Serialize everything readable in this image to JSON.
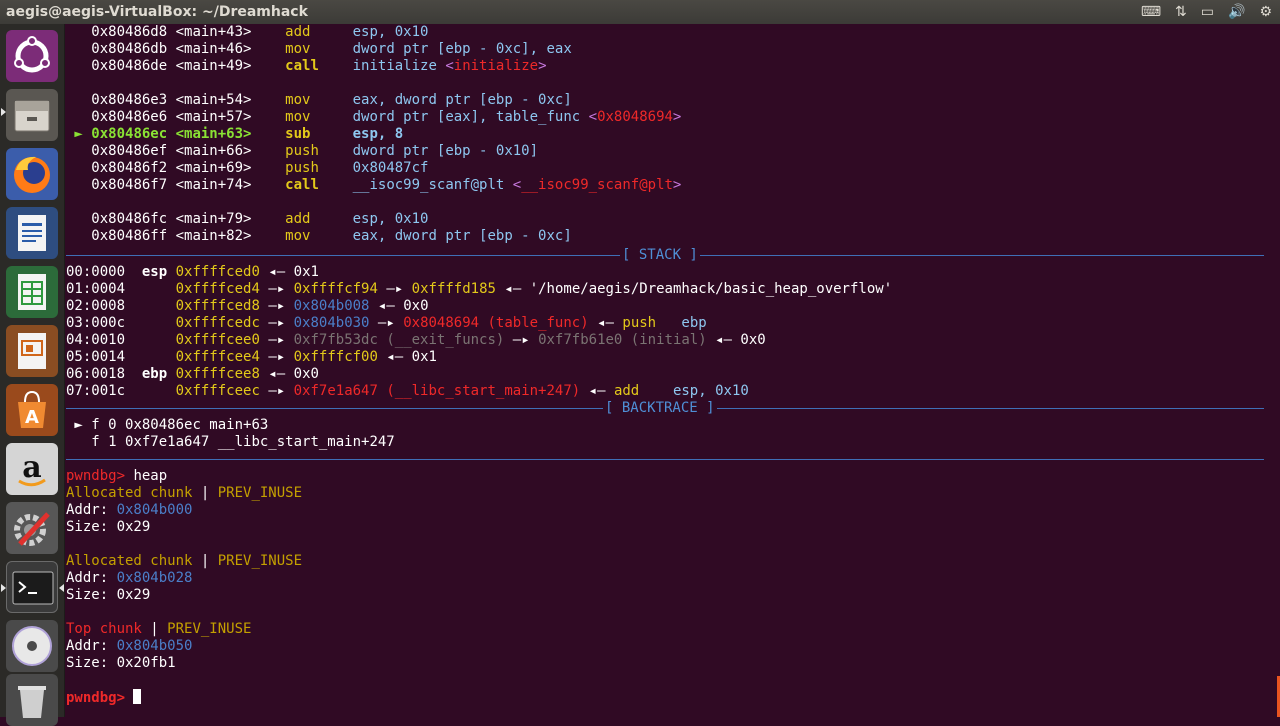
{
  "window": {
    "title": "aegis@aegis-VirtualBox: ~/Dreamhack"
  },
  "tray": {
    "keyboard": "⌨",
    "network": "⇅",
    "battery": "▭",
    "volume": "🔊",
    "power": "⚙"
  },
  "launcher": {
    "items": [
      {
        "name": "ubuntu-dash-icon"
      },
      {
        "name": "files-icon"
      },
      {
        "name": "firefox-icon"
      },
      {
        "name": "writer-icon"
      },
      {
        "name": "calc-icon"
      },
      {
        "name": "impress-icon"
      },
      {
        "name": "software-center-icon"
      },
      {
        "name": "amazon-icon"
      },
      {
        "name": "system-settings-icon"
      },
      {
        "name": "terminal-icon"
      },
      {
        "name": "dvd-icon"
      },
      {
        "name": "trash-icon"
      }
    ]
  },
  "disasm": [
    {
      "a": "0x80486d8",
      "s": "<main+43>",
      "m": "add",
      "o": "esp, 0x10"
    },
    {
      "a": "0x80486db",
      "s": "<main+46>",
      "m": "mov",
      "o": "dword ptr [ebp - 0xc], eax"
    },
    {
      "a": "0x80486de",
      "s": "<main+49>",
      "m": "call",
      "o": "initialize ",
      "t": "initialize"
    },
    {
      "a": "0x80486e3",
      "s": "<main+54>",
      "m": "mov",
      "o": "eax, dword ptr [ebp - 0xc]"
    },
    {
      "a": "0x80486e6",
      "s": "<main+57>",
      "m": "mov",
      "o": "dword ptr [eax], table_func ",
      "t": "0x8048694"
    },
    {
      "a": "0x80486ec",
      "s": "<main+63>",
      "m": "sub",
      "o": "esp, 8",
      "current": true
    },
    {
      "a": "0x80486ef",
      "s": "<main+66>",
      "m": "push",
      "o": "dword ptr [ebp - 0x10]"
    },
    {
      "a": "0x80486f2",
      "s": "<main+69>",
      "m": "push",
      "o": "0x80487cf"
    },
    {
      "a": "0x80486f7",
      "s": "<main+74>",
      "m": "call",
      "o": "__isoc99_scanf@plt ",
      "t": "__isoc99_scanf@plt"
    },
    {
      "a": "0x80486fc",
      "s": "<main+79>",
      "m": "add",
      "o": "esp, 0x10"
    },
    {
      "a": "0x80486ff",
      "s": "<main+82>",
      "m": "mov",
      "o": "eax, dword ptr [ebp - 0xc]"
    }
  ],
  "markers": {
    "current": "►",
    "lt": "<",
    "gt": ">",
    "arrow": "—▸",
    "larrow": "◂—"
  },
  "stack_header": "[ STACK ]",
  "stack": [
    {
      "idx": "00:0000",
      "reg": "esp",
      "addr": "0xffffced0",
      "val": "0x1"
    },
    {
      "idx": "01:0004",
      "addr": "0xffffced4",
      "p1": "0xffffcf94",
      "p2": "0xffffd185",
      "str": "'/home/aegis/Dreamhack/basic_heap_overflow'"
    },
    {
      "idx": "02:0008",
      "addr": "0xffffced8",
      "p1": "0x804b008",
      "val": "0x0"
    },
    {
      "idx": "03:000c",
      "addr": "0xffffcedc",
      "p1": "0x804b030",
      "p2": "0x8048694 (table_func)",
      "ins_m": "push",
      "ins_o": "ebp"
    },
    {
      "idx": "04:0010",
      "addr": "0xffffcee0",
      "p1": "0xf7fb53dc (__exit_funcs)",
      "p2": "0xf7fb61e0 (initial)",
      "val": "0x0"
    },
    {
      "idx": "05:0014",
      "addr": "0xffffcee4",
      "p1": "0xffffcf00",
      "val": "0x1"
    },
    {
      "idx": "06:0018",
      "reg": "ebp",
      "addr": "0xffffcee8",
      "val": "0x0"
    },
    {
      "idx": "07:001c",
      "addr": "0xffffceec",
      "p1": "0xf7e1a647 (__libc_start_main+247)",
      "ins_m": "add",
      "ins_o": "esp, 0x10"
    }
  ],
  "backtrace_header": "[ BACKTRACE ]",
  "backtrace": [
    {
      "marker": "►",
      "text": "f 0 0x80486ec main+63"
    },
    {
      "marker": " ",
      "text": "f 1 0xf7e1a647 __libc_start_main+247"
    }
  ],
  "prompt": "pwndbg>",
  "command": "heap",
  "heap": [
    {
      "label": "Allocated chunk",
      "flag": "PREV_INUSE",
      "addr": "0x804b000",
      "size": "0x29",
      "top": false
    },
    {
      "label": "Allocated chunk",
      "flag": "PREV_INUSE",
      "addr": "0x804b028",
      "size": "0x29",
      "top": false
    },
    {
      "label": "Top chunk",
      "flag": "PREV_INUSE",
      "addr": "0x804b050",
      "size": "0x20fb1",
      "top": true
    }
  ],
  "heap_labels": {
    "addr": "Addr: ",
    "size": "Size: ",
    "pipe": " | "
  },
  "colors": {
    "background": "#300a24",
    "green": "#8ae234",
    "yellow": "#e3c91a",
    "red": "#ef2929",
    "purple": "#c678dd",
    "blue": "#4b7fc9",
    "cyan": "#8ec7f0"
  }
}
